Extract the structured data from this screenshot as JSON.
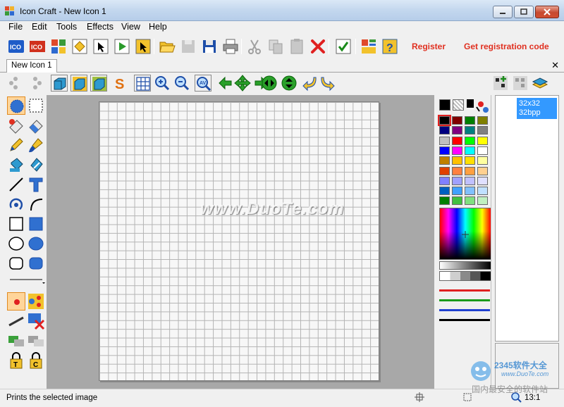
{
  "window": {
    "title": "Icon Craft - New Icon 1"
  },
  "menu": [
    "File",
    "Edit",
    "Tools",
    "Effects",
    "View",
    "Help"
  ],
  "toolbar": {
    "register_label": "Register",
    "get_code_label": "Get registration code"
  },
  "tabs": [
    {
      "label": "New Icon 1",
      "active": true
    }
  ],
  "canvas": {
    "grid_cells": 32,
    "watermark": "www.DuoTe.com"
  },
  "palette": {
    "primary_color": "#000000",
    "colors": [
      [
        "#000000",
        "#800000",
        "#008000",
        "#808000"
      ],
      [
        "#000080",
        "#800080",
        "#008080",
        "#808080"
      ],
      [
        "#c0c0c0",
        "#ff0000",
        "#00ff00",
        "#ffff00"
      ],
      [
        "#0000ff",
        "#ff00ff",
        "#00ffff",
        "#ffffff"
      ],
      [
        "#c08000",
        "#ffc000",
        "#ffe000",
        "#ffffa0"
      ],
      [
        "#e04000",
        "#ff8040",
        "#ffa040",
        "#ffd090"
      ],
      [
        "#8080ff",
        "#a0a0ff",
        "#c0c0ff",
        "#e0e0ff"
      ],
      [
        "#0060c0",
        "#40a0ff",
        "#80c0ff",
        "#c0e0ff"
      ],
      [
        "#008000",
        "#40c040",
        "#80e080",
        "#c0f0c0"
      ]
    ]
  },
  "formats": [
    {
      "label_line1": "32x32",
      "label_line2": "32bpp",
      "selected": true
    }
  ],
  "status": {
    "message": "Prints the selected image",
    "zoom": "13:1"
  },
  "overlay_watermark": {
    "line1": "2345软件大全",
    "line2": "www.DuoTe.com",
    "line3": "国内最安全的软件站"
  },
  "colors": {
    "accent_selected": "#3399ff",
    "register_red": "#e03020"
  }
}
